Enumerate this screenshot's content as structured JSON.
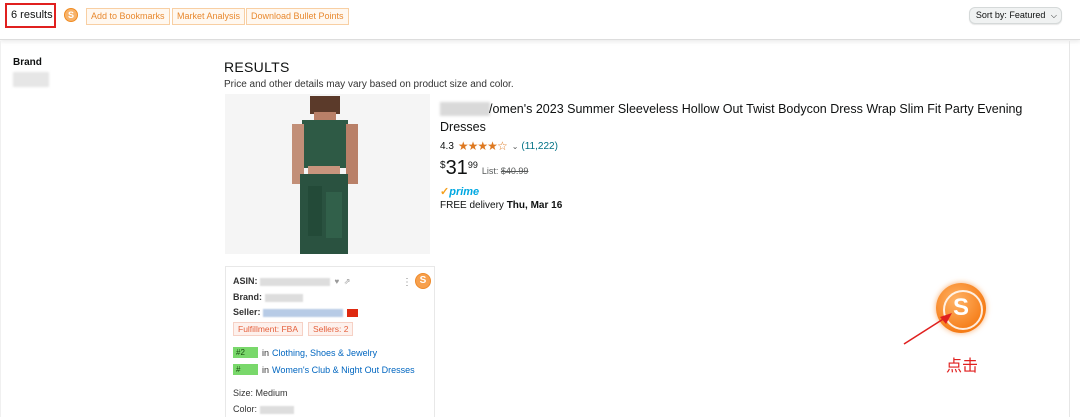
{
  "toolbar": {
    "results_count": "6 results",
    "add_bookmarks": "Add to Bookmarks",
    "market_analysis": "Market Analysis",
    "download_bullets": "Download Bullet Points",
    "sort_label": "Sort by:",
    "sort_value": "Featured"
  },
  "sidebar": {
    "brand_heading": "Brand"
  },
  "main": {
    "heading": "RESULTS",
    "subheading": "Price and other details may vary based on product size and color."
  },
  "product": {
    "title": "/omen's 2023 Summer Sleeveless Hollow Out Twist Bodycon Dress Wrap Slim Fit Party Evening Dresses",
    "rating": "4.3",
    "stars": "★★★★☆",
    "review_count": "(11,222)",
    "price_symbol": "$",
    "price_whole": "31",
    "price_fraction": "99",
    "list_label": "List:",
    "list_price": "$40.99",
    "prime_label": "prime",
    "delivery_text": "FREE delivery",
    "delivery_date": "Thu, Mar 16"
  },
  "info_card": {
    "asin_label": "ASIN:",
    "brand_label": "Brand:",
    "seller_label": "Seller:",
    "fulfillment_tag": "Fulfillment: FBA",
    "sellers_tag": "Sellers: 2",
    "rank1_badge": "#2",
    "rank1_in": "in",
    "rank1_category": "Clothing, Shoes & Jewelry",
    "rank2_badge": "#",
    "rank2_in": "in",
    "rank2_category": "Women's Club & Night Out Dresses",
    "size_label": "Size:",
    "size_value": "Medium",
    "color_label": "Color:"
  },
  "annotation": {
    "click_hint": "点击"
  },
  "colors": {
    "highlight_red": "#e0201f",
    "extension_orange": "#f57c17",
    "star_orange": "#de7921",
    "link_teal": "#007185",
    "prime_blue": "#00a8e1",
    "rank_green": "#79d86b"
  }
}
